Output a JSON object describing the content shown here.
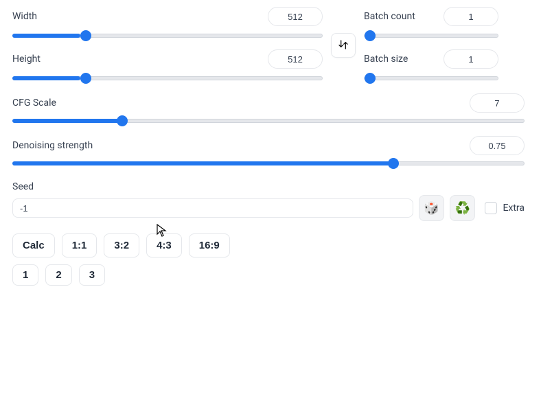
{
  "dimensions": {
    "width_label": "Width",
    "width_value": "512",
    "width_min": 64,
    "width_max": 2048,
    "width_current": 512,
    "height_label": "Height",
    "height_value": "512",
    "height_min": 64,
    "height_max": 2048,
    "height_current": 512
  },
  "batch": {
    "count_label": "Batch count",
    "count_value": "1",
    "count_min": 1,
    "count_max": 100,
    "count_current": 1,
    "size_label": "Batch size",
    "size_value": "1",
    "size_min": 1,
    "size_max": 100,
    "size_current": 1
  },
  "cfg": {
    "label": "CFG Scale",
    "value": "7",
    "min": 1,
    "max": 30,
    "current": 7
  },
  "denoise": {
    "label": "Denoising strength",
    "value": "0.75",
    "min": 0,
    "max": 1,
    "current": 0.75
  },
  "seed": {
    "label": "Seed",
    "value": "-1",
    "extra_label": "Extra",
    "extra_checked": false
  },
  "icons": {
    "swap": "swap",
    "dice": "🎲",
    "recycle": "♻️"
  },
  "ratio_buttons": [
    "Calc",
    "1:1",
    "3:2",
    "4:3",
    "16:9"
  ],
  "preset_buttons": [
    "1",
    "2",
    "3"
  ]
}
